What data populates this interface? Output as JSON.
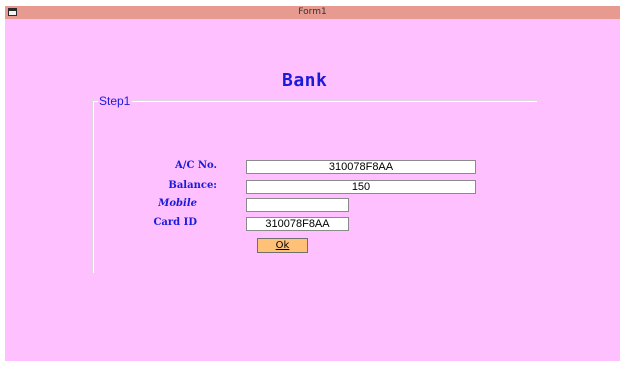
{
  "window": {
    "title": "Form1"
  },
  "header": {
    "title": "Bank"
  },
  "group": {
    "label": "Step1"
  },
  "form": {
    "account_label": "A/C No.",
    "account_value": "310078F8AA",
    "balance_label": "Balance:",
    "balance_value": "150",
    "mobile_label": "Mobile",
    "mobile_value": "",
    "card_label": "Card ID",
    "card_value": "310078F8AA"
  },
  "actions": {
    "ok_label": "Ok"
  },
  "colors": {
    "background": "#ffc0ff",
    "titlebar": "#e79a8f",
    "label_text": "#1a1ad8",
    "button": "#ffc078"
  },
  "icons": {
    "window_icon": "window-system-icon"
  }
}
